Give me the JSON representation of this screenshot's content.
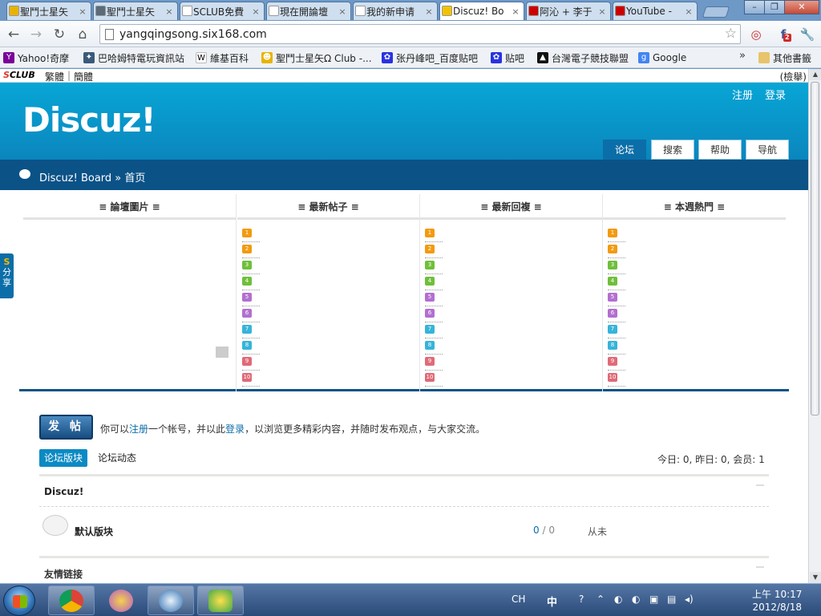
{
  "browser": {
    "tabs": [
      {
        "title": "聖鬥士星矢",
        "favicon_color": "#e8b300",
        "active": false
      },
      {
        "title": "聖鬥士星矢",
        "favicon_color": "#5a6b7a",
        "active": false
      },
      {
        "title": "SCLUB免費",
        "favicon_color": "#ffffff",
        "active": false
      },
      {
        "title": "現在開論壇",
        "favicon_color": "#ffffff",
        "active": false
      },
      {
        "title": "我的新申请",
        "favicon_color": "#ffffff",
        "active": false
      },
      {
        "title": "Discuz! Bo",
        "favicon_color": "#f2c200",
        "active": true
      },
      {
        "title": "阿沁 + 李于",
        "favicon_color": "#cc0000",
        "active": false
      },
      {
        "title": "YouTube -",
        "favicon_color": "#cc0000",
        "active": false
      }
    ],
    "close_glyph": "×",
    "window_buttons": {
      "minimize": "–",
      "maximize": "❐",
      "close": "✕"
    },
    "nav": {
      "back": "←",
      "forward": "→",
      "reload": "↻",
      "home": "⌂"
    },
    "address": "yangqingsong.six168.com",
    "star": "☆",
    "extensions": {
      "weibo": "◎",
      "fb_badge": "2",
      "fb": "f",
      "wrench": "🔧"
    },
    "bookmarks": [
      {
        "label": "Yahoo!奇摩",
        "icon_color": "#7b0099",
        "icon": "Y"
      },
      {
        "label": "巴哈姆特電玩資訊站",
        "icon_color": "#3a5a7a",
        "icon": "✦"
      },
      {
        "label": "維基百科",
        "icon_color": "#ffffff",
        "icon": "W"
      },
      {
        "label": "聖鬥士星矢Ω Club -...",
        "icon_color": "#e8b300",
        "icon": "☻"
      },
      {
        "label": "张丹峰吧_百度贴吧",
        "icon_color": "#2932e1",
        "icon": "✿"
      },
      {
        "label": "贴吧",
        "icon_color": "#2932e1",
        "icon": "✿"
      },
      {
        "label": "台灣電子競技聯盟",
        "icon_color": "#111111",
        "icon": "▲"
      },
      {
        "label": "Google",
        "icon_color": "#4285f4",
        "icon": "g"
      }
    ],
    "more": "»",
    "other_bookmarks": "其他書籤"
  },
  "sclub_bar": {
    "logo_s": "S",
    "logo_rest": "CLUB",
    "trad": "繁體",
    "divider": "|",
    "simp": "簡體",
    "report": "(檢舉)"
  },
  "site": {
    "logo": "Discuz!",
    "top_links": {
      "register": "注册",
      "login": "登录"
    },
    "nav_tabs": [
      {
        "label": "论坛",
        "active": true
      },
      {
        "label": "搜索",
        "active": false
      },
      {
        "label": "帮助",
        "active": false
      },
      {
        "label": "导航",
        "active": false
      }
    ],
    "breadcrumb": {
      "home": "Discuz! Board",
      "sep": "»",
      "current": "首页"
    },
    "hot_columns": [
      {
        "title": "≡ 論壇圖片 ≡",
        "has_list": false
      },
      {
        "title": "≡ 最新帖子 ≡",
        "has_list": true
      },
      {
        "title": "≡ 最新回複 ≡",
        "has_list": true
      },
      {
        "title": "≡ 本週熱門 ≡",
        "has_list": true
      }
    ],
    "rank_numbers": [
      "1",
      "2",
      "3",
      "4",
      "5",
      "6",
      "7",
      "8",
      "9",
      "10"
    ],
    "rank_colors": [
      "#f29a0f",
      "#f29a0f",
      "#6fbf3a",
      "#6fbf3a",
      "#b36fd0",
      "#b36fd0",
      "#36b4d9",
      "#36b4d9",
      "#e06a78",
      "#e06a78"
    ],
    "share_tab": {
      "s": "S",
      "line1": "分",
      "line2": "享"
    },
    "post_button": "发 帖",
    "invite": {
      "prefix": "你可以",
      "register": "注册",
      "mid": "一个帐号，并以此",
      "login": "登录",
      "suffix": "，以浏览更多精彩内容，并随时发布观点，与大家交流。"
    },
    "subtabs": [
      {
        "label": "论坛版块",
        "active": true
      },
      {
        "label": "论坛动态",
        "active": false
      }
    ],
    "stats": "今日: 0, 昨日: 0, 会员: 1",
    "forum_group": "Discuz!",
    "forum": {
      "name": "默认版块",
      "threads": "0",
      "slash": " / ",
      "posts": "0",
      "last": "从未"
    },
    "links_title": "友情链接"
  },
  "taskbar": {
    "lang": "CH",
    "ime": "中",
    "tray_icons": [
      "?",
      "⌃",
      "◐",
      "◐",
      "▣",
      "▤",
      "◂)"
    ],
    "time": "上午 10:17",
    "date": "2012/8/18"
  }
}
